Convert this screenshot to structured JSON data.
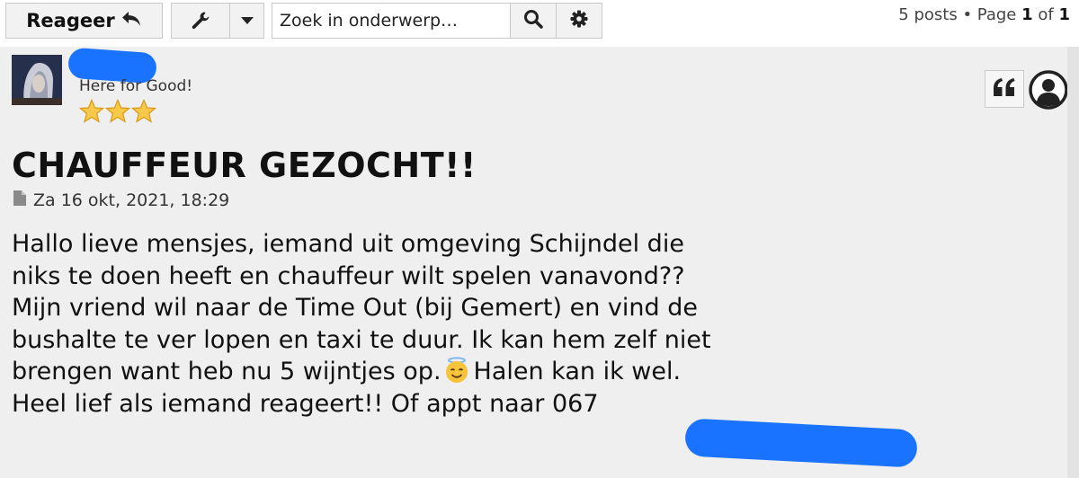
{
  "toolbar": {
    "reply_label": "Reageer",
    "search_placeholder": "Zoek in onderwerp…",
    "pagination": {
      "posts": "5 posts",
      "separator": "•",
      "page_word": "Page",
      "current": "1",
      "of_word": "of",
      "total": "1"
    }
  },
  "post": {
    "author_rank": "Here for Good!",
    "rank_stars": 3,
    "title": "CHAUFFEUR GEZOCHT!!",
    "date": "Za 16 okt, 2021, 18:29",
    "body": {
      "line1": "Hallo lieve mensjes, iemand uit omgeving Schijndel die",
      "line2": "niks te doen heeft en chauffeur wilt spelen vanavond??",
      "line3": "Mijn vriend wil naar de Time Out (bij Gemert) en vind de",
      "line4": "bushalte te ver lopen en taxi te duur. Ik kan hem zelf niet",
      "line5a": "brengen want heb nu 5 wijntjes op.",
      "line5b": "Halen kan ik wel.",
      "line6": "Heel lief als iemand reageert!! Of appt naar 067"
    }
  },
  "colors": {
    "redaction": "#1a73ff",
    "star": "#f5b52e",
    "post_background": "#efefef"
  }
}
